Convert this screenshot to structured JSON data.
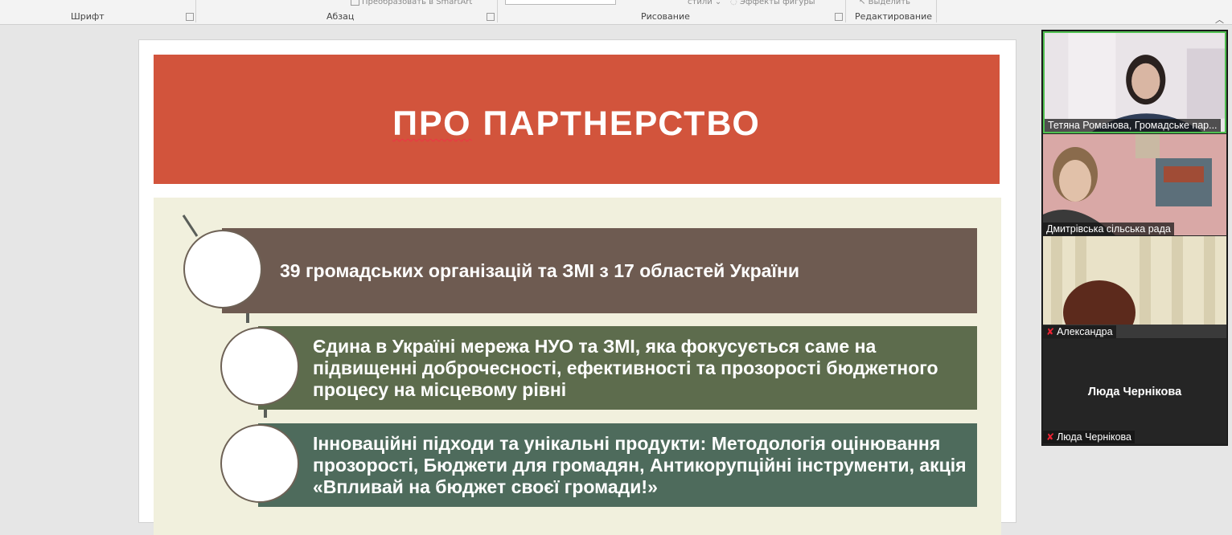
{
  "ribbon": {
    "groups": [
      "Шрифт",
      "Абзац",
      "Рисование",
      "Редактирование"
    ],
    "partial": [
      "Преобразовать в SmartArt",
      "стили",
      "Эффекты фигуры",
      "Выделить"
    ],
    "collapse_icon": "chevron-up-icon"
  },
  "slide": {
    "title": [
      "ПРО",
      "ПАРТНЕРСТВО"
    ],
    "rows": [
      {
        "text": "39 громадських організацій та ЗМІ з 17 областей України",
        "color": "#6e5b51"
      },
      {
        "text": "Єдина в Україні мережа НУО та ЗМІ, яка фокусується саме на підвищенні доброчесності, ефективності та прозорості бюджетного процесу на місцевому рівні",
        "color": "#5d6c4d"
      },
      {
        "text": "Інноваційні підходи та унікальні продукти: Методологія оцінювання прозорості, Бюджети для громадян, Антикорупційні інструменти, акція «Впливай на бюджет своєї громади!»",
        "color": "#4e6b5c"
      }
    ]
  },
  "participants": [
    {
      "name": "Тетяна Романова, Громадське пар...",
      "muted": false,
      "active": true
    },
    {
      "name": "Дмитрівська сільська рада",
      "muted": false,
      "active": false
    },
    {
      "name": "Александра",
      "muted": true,
      "active": false
    },
    {
      "name": "Люда Чернікова",
      "display_name": "Люда Чернікова",
      "muted": true,
      "active": false
    }
  ],
  "colors": {
    "title_bg": "#d2543c",
    "content_bg": "#f1f0dd",
    "active_border": "#4fbf4f"
  }
}
